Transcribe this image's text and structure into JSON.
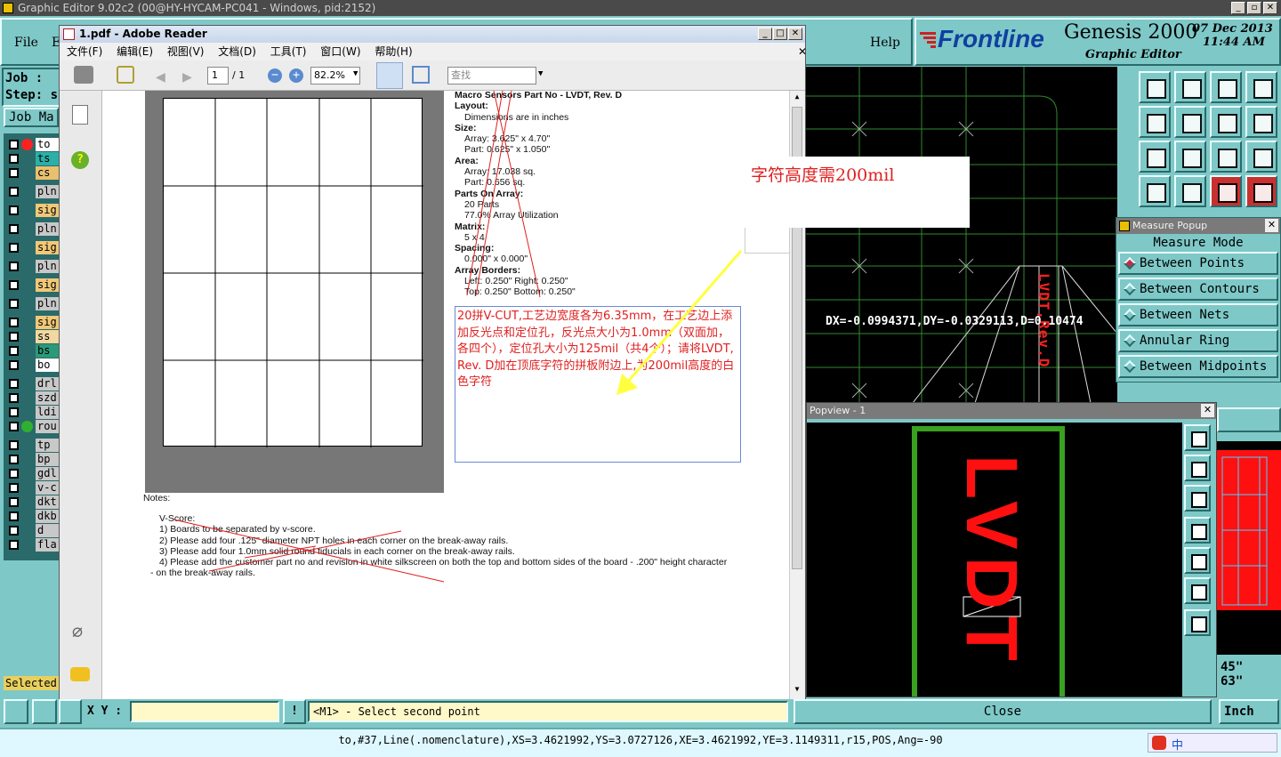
{
  "app": {
    "title": "Graphic Editor 9.02c2 (00@HY-HYCAM-PC041 - Windows, pid:2152)",
    "min": "_",
    "max": "▫",
    "close": "✕"
  },
  "menu": {
    "file": "File",
    "edit": "E",
    "help": "Help"
  },
  "logo": {
    "brand": "Frontline",
    "product": "Genesis 2000",
    "sub": "Graphic Editor",
    "date": "07 Dec 2013",
    "time": "11:44 AM"
  },
  "left": {
    "job": "Job :",
    "step": "Step: s",
    "job_matrix": "Job Ma",
    "layers": [
      {
        "n": "to",
        "c": "#ffffff"
      },
      {
        "n": "ts",
        "c": "#2bb0a8"
      },
      {
        "n": "cs",
        "c": "#e8c070"
      },
      {
        "n": "pln",
        "c": "#c8c8c8"
      },
      {
        "n": "sig",
        "c": "#f0c878"
      },
      {
        "n": "pln",
        "c": "#c8c8c8"
      },
      {
        "n": "sig",
        "c": "#f0c878"
      },
      {
        "n": "pln",
        "c": "#c8c8c8"
      },
      {
        "n": "sig",
        "c": "#f0c878"
      },
      {
        "n": "pln",
        "c": "#c8c8c8"
      },
      {
        "n": "sig",
        "c": "#f0c878"
      },
      {
        "n": "ss",
        "c": "#f0d8a0"
      },
      {
        "n": "bs",
        "c": "#2a9a78"
      },
      {
        "n": "bo",
        "c": "#ffffff"
      },
      {
        "n": "drl",
        "c": "#c8c8c8"
      },
      {
        "n": "szd",
        "c": "#c8c8c8"
      },
      {
        "n": "ldi",
        "c": "#c8c8c8"
      },
      {
        "n": "rou",
        "c": "#c8c8c8"
      },
      {
        "n": "tp",
        "c": "#c8c8c8"
      },
      {
        "n": "bp",
        "c": "#c8c8c8"
      },
      {
        "n": "gdl",
        "c": "#c8c8c8"
      },
      {
        "n": "v-c",
        "c": "#c8c8c8"
      },
      {
        "n": "dkt",
        "c": "#c8c8c8"
      },
      {
        "n": "dkb",
        "c": "#c8c8c8"
      },
      {
        "n": "d",
        "c": "#c8c8c8"
      },
      {
        "n": "fla",
        "c": "#c8c8c8"
      }
    ],
    "selected": "Selected"
  },
  "reader": {
    "title": "1.pdf - Adobe Reader",
    "menus": [
      "文件(F)",
      "编辑(E)",
      "视图(V)",
      "文档(D)",
      "工具(T)",
      "窗口(W)",
      "帮助(H)"
    ],
    "page_current": "1",
    "page_total": "/ 1",
    "zoom": "82.2%",
    "search_placeholder": "查找",
    "spec": [
      {
        "b": "Macro Sensors Part No - LVDT, Rev. D"
      },
      {
        "b": "Layout:"
      },
      {
        "t": "Dimensions are in inches"
      },
      {
        "b": "Size:"
      },
      {
        "t": "Array: 3.625\" x 4.70\""
      },
      {
        "t": "Part: 0.625\" x 1.050\""
      },
      {
        "b": "Area:"
      },
      {
        "t": "Array: 17.038 sq."
      },
      {
        "t": "Part: 0.656 sq."
      },
      {
        "b": "Parts On Array:"
      },
      {
        "t": "20 Parts"
      },
      {
        "t": "77.0% Array Utilization"
      },
      {
        "b": "Matrix:"
      },
      {
        "t": "5 x 4"
      },
      {
        "b": "Spacing:"
      },
      {
        "t": "0.000\" x 0.000\""
      },
      {
        "b": "Array Borders:"
      },
      {
        "t": "Left: 0.250\"  Right: 0.250\""
      },
      {
        "t": "Top: 0.250\"  Bottom: 0.250\""
      }
    ],
    "notes_title": "Notes:",
    "notes": [
      "V-Score:",
      "1) Boards to be separated by v-score.",
      "2) Please add four .125\" diameter NPT holes in each corner on the break-away rails.",
      "3) Please add four 1.0mm solid round fiducials in each corner on the break-away rails.",
      "4) Please add the customer part no and revision in white silkscreen on both the top and bottom sides of the board - .200\" height character",
      "- on the break-away rails."
    ],
    "annotation": "20拼V-CUT,工艺边宽度各为6.35mm，在工艺边上添加反光点和定位孔，反光点大小为1.0mm（双面加，各四个），定位孔大小为125mil（共4个）；请将LVDT, Rev. D加在顶底字符的拼板附边上,为200mil高度的白色字符",
    "callout": "字符高度需200mil"
  },
  "cad": {
    "measure_text": "DX=-0.0994371,DY=-0.0329113,D=0.10474",
    "vertical_text": "LVDT,Rev.D"
  },
  "measure": {
    "title": "Measure Popup",
    "mode": "Measure Mode",
    "options": [
      "Between Points",
      "Between Contours",
      "Between Nets",
      "Annular Ring",
      "Between Midpoints"
    ],
    "selected_index": 0
  },
  "popview": {
    "title": "Popview - 1",
    "text": "LVDT",
    "close": "Close"
  },
  "right_bottom": {
    "v1": "45\"",
    "v2": "63\"",
    "unit": "Inch"
  },
  "bottom": {
    "xy_label": "X Y :",
    "xy_value": "",
    "prompt": "<M1> - Select second point"
  },
  "status": {
    "text": "to,#37,Line(.nomenclature),XS=3.4621992,YS=3.0727126,XE=3.4621992,YE=3.1149311,r15,POS,Ang=-90"
  },
  "colors": {
    "teal": "#7fc8c8",
    "red": "#ff2020",
    "green": "#3aa020",
    "annot_red": "#e02020"
  }
}
